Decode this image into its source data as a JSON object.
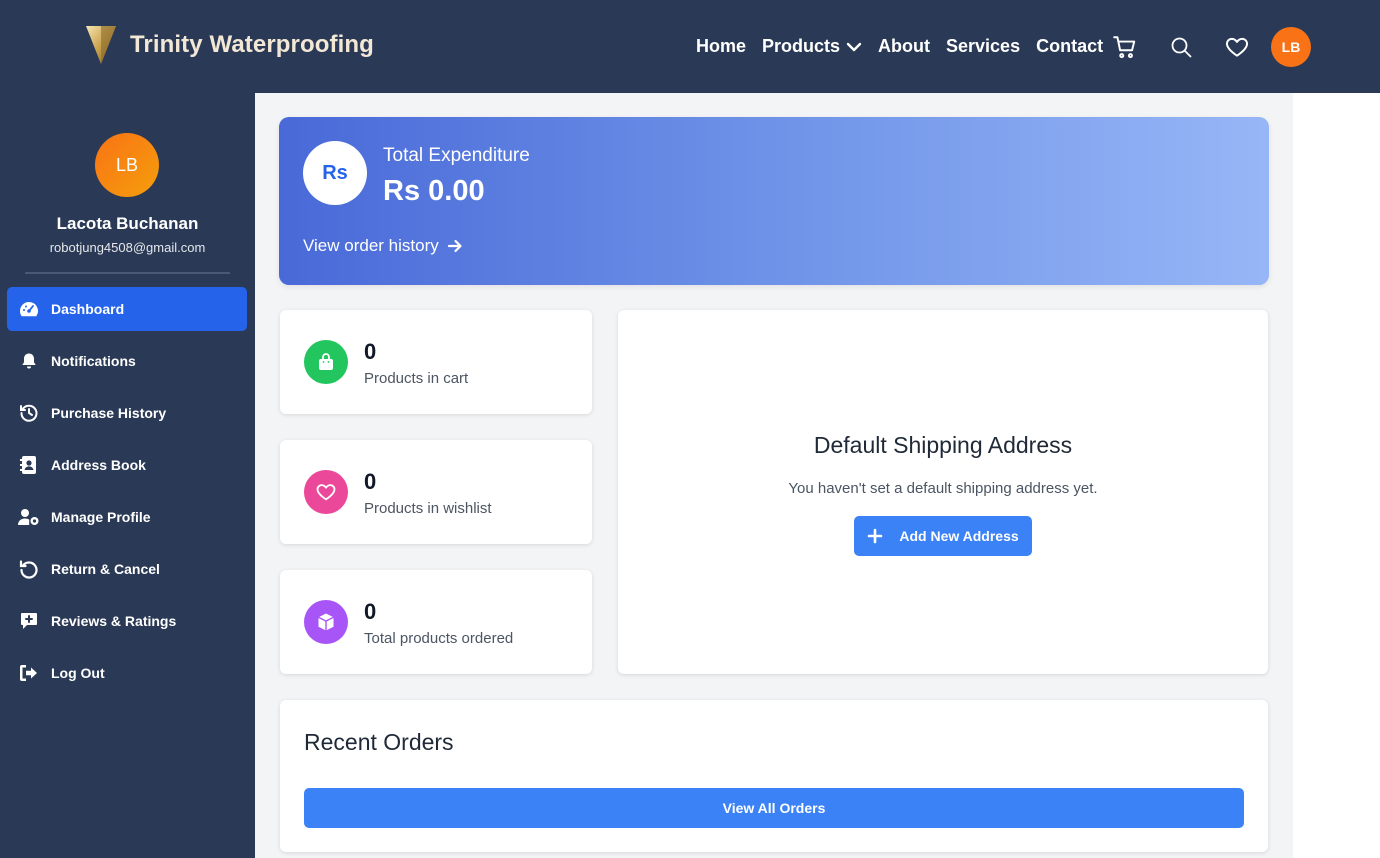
{
  "header": {
    "brand": "Trinity Waterproofing",
    "nav": [
      {
        "label": "Home"
      },
      {
        "label": "Products"
      },
      {
        "label": "About"
      },
      {
        "label": "Services"
      },
      {
        "label": "Contact"
      }
    ],
    "icons": [
      "cart-icon",
      "search-icon",
      "heart-icon"
    ],
    "avatar_initials": "LB"
  },
  "sidebar": {
    "avatar_initials": "LB",
    "name": "Lacota Buchanan",
    "email": "robotjung4508@gmail.com",
    "items": [
      {
        "label": "Dashboard",
        "icon": "gauge-icon",
        "active": true
      },
      {
        "label": "Notifications",
        "icon": "bell-icon"
      },
      {
        "label": "Purchase History",
        "icon": "history-icon"
      },
      {
        "label": "Address Book",
        "icon": "address-book-icon"
      },
      {
        "label": "Manage Profile",
        "icon": "user-gear-icon"
      },
      {
        "label": "Return & Cancel",
        "icon": "rotate-left-icon"
      },
      {
        "label": "Reviews & Ratings",
        "icon": "comment-plus-icon"
      },
      {
        "label": "Log Out",
        "icon": "logout-icon"
      }
    ]
  },
  "hero": {
    "currency_badge": "Rs",
    "label": "Total Expenditure",
    "amount": "Rs 0.00",
    "link": "View order history"
  },
  "stats": [
    {
      "value": "0",
      "label": "Products in cart",
      "color": "#22c55e",
      "icon": "shopping-bag-icon"
    },
    {
      "value": "0",
      "label": "Products in wishlist",
      "color": "#ec4899",
      "icon": "heart-icon"
    },
    {
      "value": "0",
      "label": "Total products ordered",
      "color": "#a855f7",
      "icon": "box-icon"
    }
  ],
  "shipping": {
    "title": "Default Shipping Address",
    "text": "You haven't set a default shipping address yet.",
    "button": "Add New Address"
  },
  "recent_orders": {
    "title": "Recent Orders",
    "button": "View All Orders"
  },
  "colors": {
    "navy": "#2a3a56",
    "primary": "#2563eb",
    "button": "#3b82f6",
    "avatar": "#f97316"
  }
}
